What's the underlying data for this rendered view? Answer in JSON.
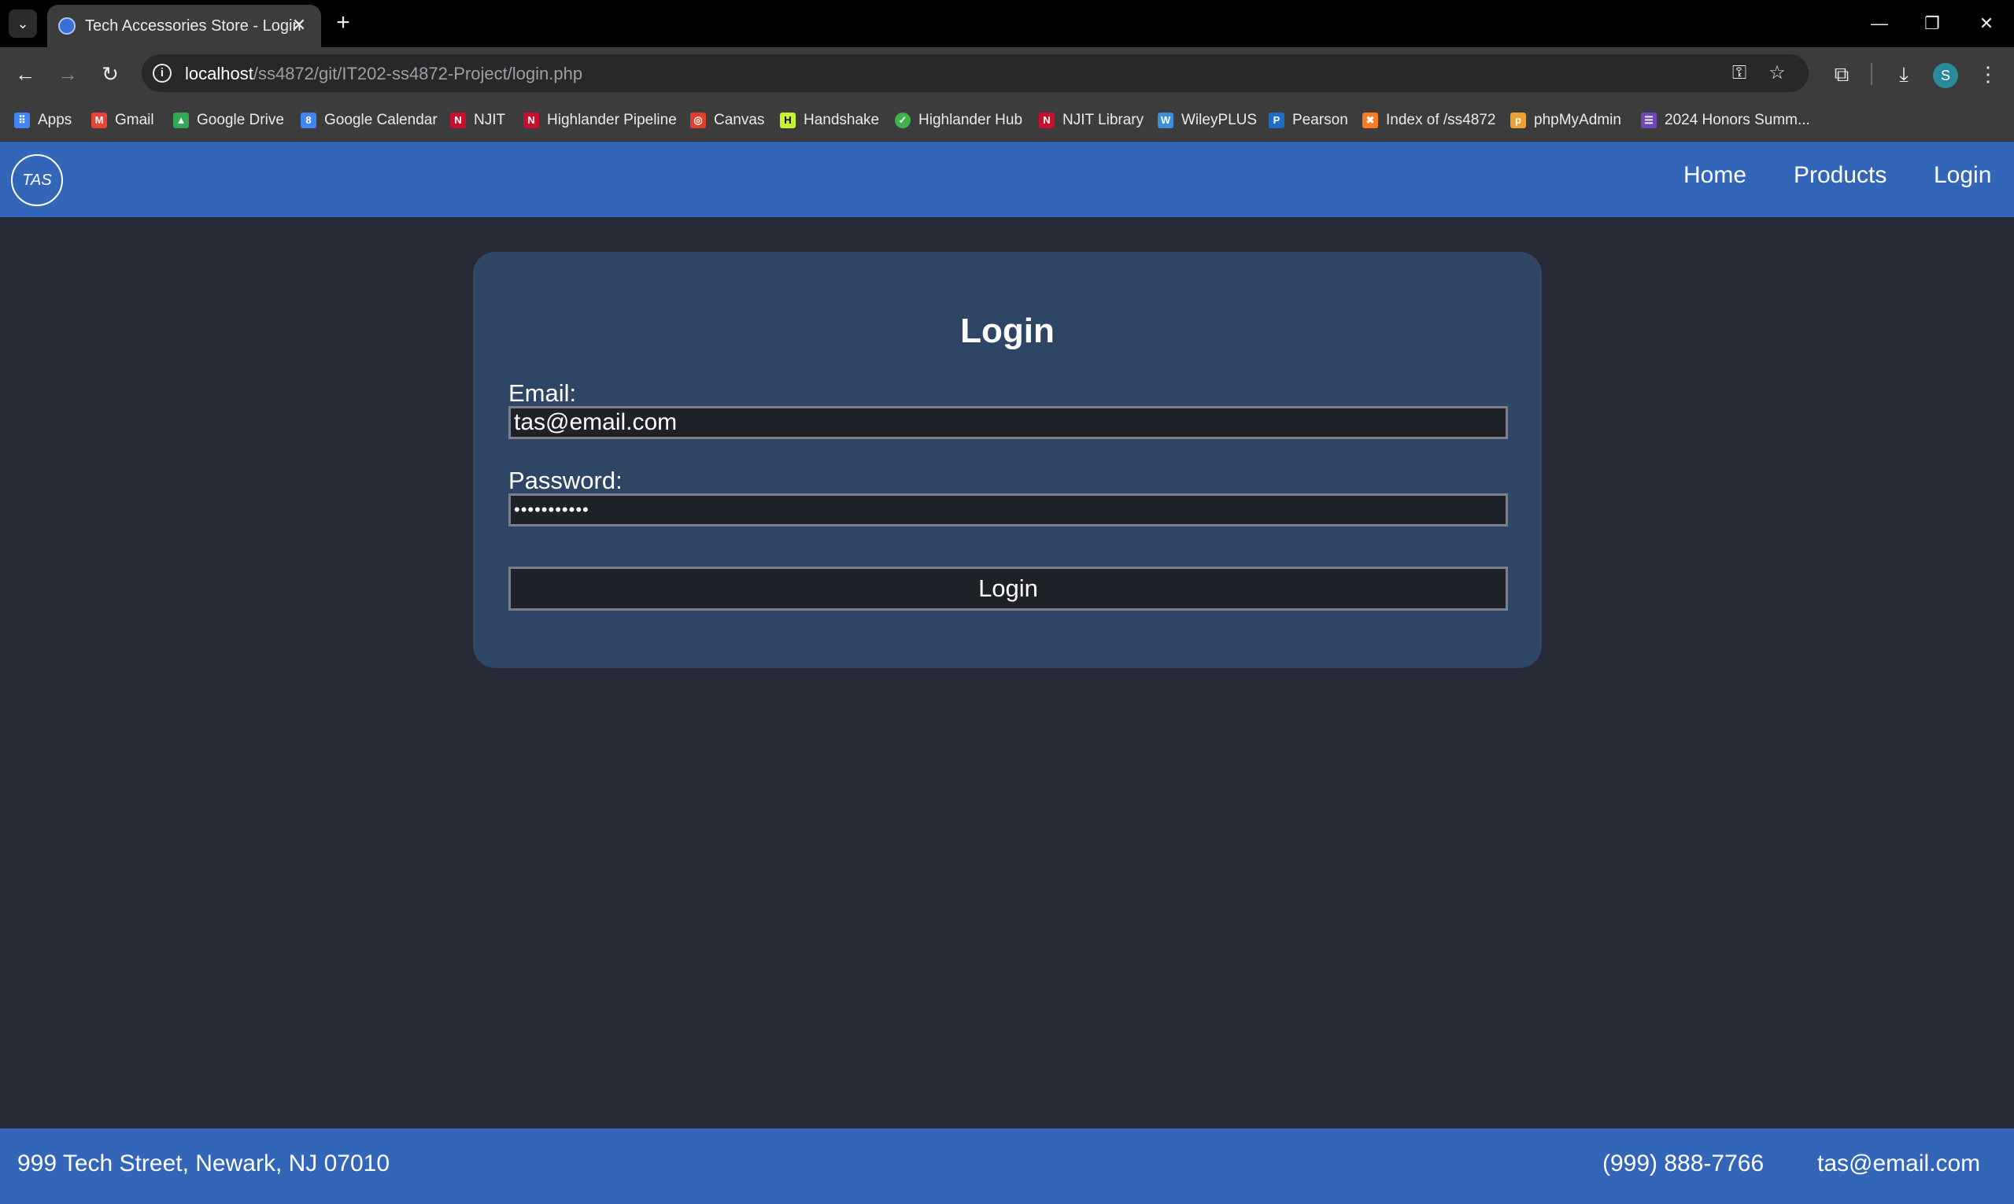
{
  "browser": {
    "tab_title": "Tech Accessories Store - Login",
    "url_host": "localhost",
    "url_path": "/ss4872/git/IT202-ss4872-Project/login.php",
    "profile_initial": "S",
    "bookmarks": [
      {
        "label": "Apps",
        "icon": "apps-grid-icon",
        "color": "#4285f4"
      },
      {
        "label": "Gmail",
        "icon": "gmail-icon",
        "color": "#ea4335"
      },
      {
        "label": "Google Drive",
        "icon": "google-drive-icon",
        "color": "#34a853"
      },
      {
        "label": "Google Calendar",
        "icon": "google-calendar-icon",
        "color": "#4285f4"
      },
      {
        "label": "NJIT",
        "icon": "njit-icon",
        "color": "#c8102e"
      },
      {
        "label": "Highlander Pipeline",
        "icon": "njit-icon",
        "color": "#c8102e"
      },
      {
        "label": "Canvas",
        "icon": "canvas-icon",
        "color": "#e13f2b"
      },
      {
        "label": "Handshake",
        "icon": "handshake-icon",
        "color": "#c6f432"
      },
      {
        "label": "Highlander Hub",
        "icon": "highlander-hub-icon",
        "color": "#3cb44a"
      },
      {
        "label": "NJIT Library",
        "icon": "njit-icon",
        "color": "#c8102e"
      },
      {
        "label": "WileyPLUS",
        "icon": "wileyplus-icon",
        "color": "#3b8fd9"
      },
      {
        "label": "Pearson",
        "icon": "pearson-icon",
        "color": "#1b6ec2"
      },
      {
        "label": "Index of /ss4872",
        "icon": "xampp-icon",
        "color": "#fb7a24"
      },
      {
        "label": "phpMyAdmin",
        "icon": "phpmyadmin-icon",
        "color": "#f0a030"
      },
      {
        "label": "2024 Honors Summ...",
        "icon": "forms-icon",
        "color": "#7248b9"
      }
    ]
  },
  "site": {
    "logo_text": "TAS",
    "nav": {
      "home": "Home",
      "products": "Products",
      "login": "Login"
    }
  },
  "login_form": {
    "title": "Login",
    "email_label": "Email:",
    "email_value": "tas@email.com",
    "password_label": "Password:",
    "password_value": "•••••••••••",
    "submit_label": "Login"
  },
  "footer": {
    "address": "999 Tech Street, Newark, NJ 07010",
    "phone": "(999) 888-7766",
    "email": "tas@email.com"
  },
  "colors": {
    "header_blue": "#3366b8",
    "page_bg": "#252a34",
    "card_bg": "#2e4566"
  }
}
